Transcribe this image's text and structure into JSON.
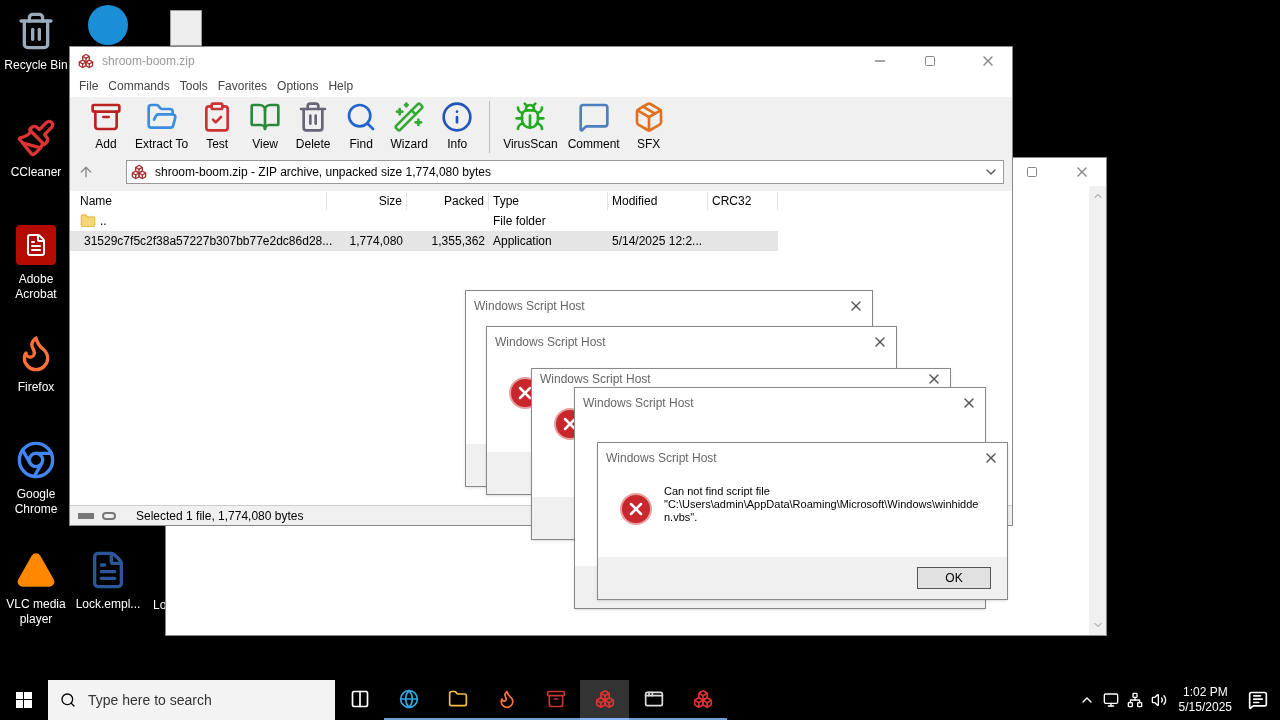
{
  "desktop_icons": [
    {
      "kind": "recycle",
      "label": "Recycle Bin"
    },
    {
      "kind": "ccleaner",
      "label": "CCleaner"
    },
    {
      "kind": "acrobat",
      "label": "Adobe Acrobat"
    },
    {
      "kind": "firefox",
      "label": "Firefox"
    },
    {
      "kind": "chrome",
      "label": "Google Chrome"
    },
    {
      "kind": "vlc",
      "label": "VLC media player"
    },
    {
      "kind": "word",
      "label": "Lock.empl..."
    },
    {
      "kind": "partial",
      "label": "Lo"
    }
  ],
  "winrar": {
    "title": "shroom-boom.zip",
    "menu": [
      "File",
      "Commands",
      "Tools",
      "Favorites",
      "Options",
      "Help"
    ],
    "toolbar": [
      {
        "kind": "add",
        "label": "Add"
      },
      {
        "kind": "extract",
        "label": "Extract To"
      },
      {
        "kind": "test",
        "label": "Test"
      },
      {
        "kind": "view",
        "label": "View"
      },
      {
        "kind": "delete",
        "label": "Delete"
      },
      {
        "kind": "find",
        "label": "Find"
      },
      {
        "kind": "wizard",
        "label": "Wizard"
      },
      {
        "kind": "info",
        "label": "Info"
      },
      {
        "kind": "virus",
        "label": "VirusScan"
      },
      {
        "kind": "comment",
        "label": "Comment"
      },
      {
        "kind": "sfx",
        "label": "SFX"
      }
    ],
    "address": "shroom-boom.zip - ZIP archive, unpacked size 1,774,080 bytes",
    "columns": [
      "Name",
      "Size",
      "Packed",
      "Type",
      "Modified",
      "CRC32"
    ],
    "rows": [
      {
        "kind": "folder",
        "name": "..",
        "type": "File folder",
        "selected": false
      },
      {
        "kind": "file",
        "name": "31529c7f5c2f38a57227b307bb77e2dc86d28...",
        "size": "1,774,080",
        "packed": "1,355,362",
        "type": "Application",
        "modified": "5/14/2025 12:2...",
        "selected": true
      }
    ],
    "status": "Selected 1 file, 1,774,080 bytes"
  },
  "dialogs": [
    {
      "kind": "plain",
      "title": "Windows Script Host"
    },
    {
      "kind": "error",
      "title": "Windows Script Host"
    },
    {
      "kind": "error",
      "title": "Windows Script Host"
    },
    {
      "kind": "plain",
      "title": "Windows Script Host"
    },
    {
      "kind": "message",
      "title": "Windows Script Host",
      "message": [
        "Can not find script file",
        "\"C:\\Users\\admin\\AppData\\Roaming\\Microsoft\\Windows\\winhidden.vbs\"."
      ],
      "button": "OK"
    }
  ],
  "taskbar": {
    "search_placeholder": "Type here to search",
    "apps": [
      {
        "kind": "taskview",
        "selected": false
      },
      {
        "kind": "edge",
        "selected": false
      },
      {
        "kind": "explorer",
        "selected": false
      },
      {
        "kind": "firefox",
        "selected": false
      },
      {
        "kind": "winrar",
        "selected": false
      },
      {
        "kind": "script",
        "selected": true
      },
      {
        "kind": "window",
        "selected": false
      },
      {
        "kind": "script",
        "selected": false
      }
    ],
    "time": "1:02 PM",
    "date": "5/15/2025"
  }
}
